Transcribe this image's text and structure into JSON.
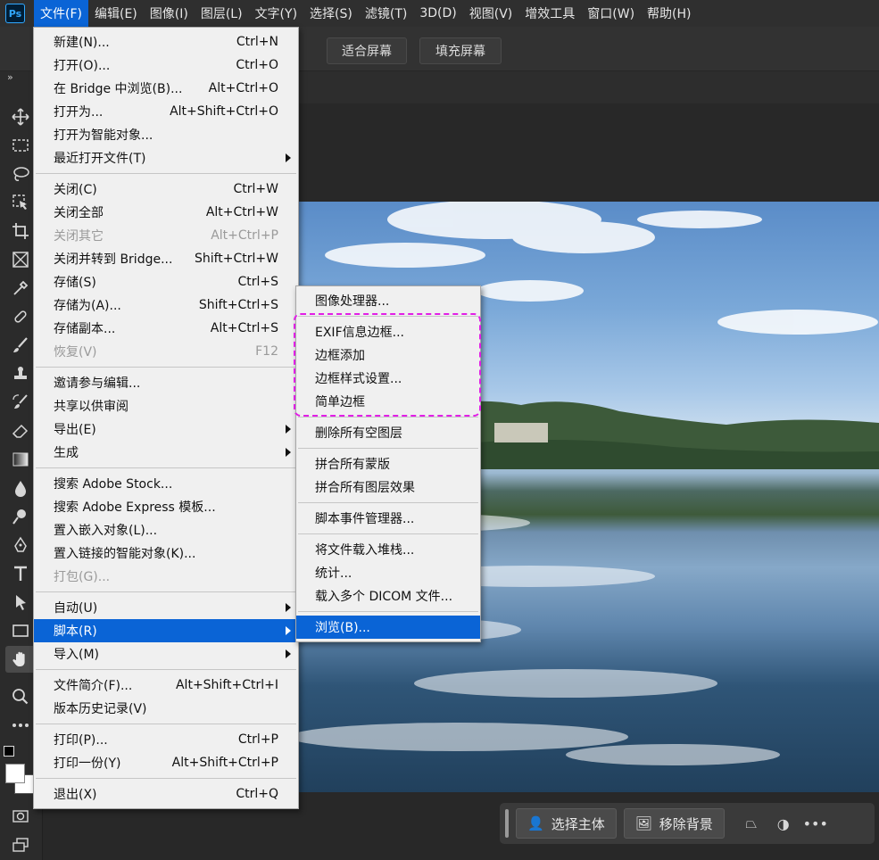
{
  "app": {
    "logo": "Ps",
    "accent": "#0a64d6",
    "highlight_box_color": "#e11ee6"
  },
  "menubar": {
    "items": [
      "文件(F)",
      "编辑(E)",
      "图像(I)",
      "图层(L)",
      "文字(Y)",
      "选择(S)",
      "滤镜(T)",
      "3D(D)",
      "视图(V)",
      "增效工具",
      "窗口(W)",
      "帮助(H)"
    ],
    "active_index": 0
  },
  "options": {
    "fit_screen": "适合屏幕",
    "fill_screen": "填充屏幕"
  },
  "toolbar": {
    "collapse": "»",
    "tools": [
      "move-icon",
      "marquee-icon",
      "lasso-icon",
      "object-select-icon",
      "crop-icon",
      "frame-icon",
      "eyedropper-icon",
      "healing-brush-icon",
      "brush-icon",
      "clone-stamp-icon",
      "history-brush-icon",
      "eraser-icon",
      "gradient-icon",
      "blur-icon",
      "dodge-icon",
      "pen-icon",
      "type-icon",
      "path-select-icon",
      "rectangle-icon",
      "hand-icon",
      "zoom-icon",
      "more-icon"
    ],
    "selected_tool": "hand-icon"
  },
  "file_menu": {
    "new": {
      "label": "新建(N)...",
      "shortcut": "Ctrl+N"
    },
    "open": {
      "label": "打开(O)...",
      "shortcut": "Ctrl+O"
    },
    "browse_bridge": {
      "label": "在 Bridge 中浏览(B)...",
      "shortcut": "Alt+Ctrl+O"
    },
    "open_as": {
      "label": "打开为...",
      "shortcut": "Alt+Shift+Ctrl+O"
    },
    "open_smart": {
      "label": "打开为智能对象..."
    },
    "recent": {
      "label": "最近打开文件(T)"
    },
    "close": {
      "label": "关闭(C)",
      "shortcut": "Ctrl+W"
    },
    "close_all": {
      "label": "关闭全部",
      "shortcut": "Alt+Ctrl+W"
    },
    "close_others": {
      "label": "关闭其它",
      "shortcut": "Alt+Ctrl+P"
    },
    "close_go_bridge": {
      "label": "关闭并转到 Bridge...",
      "shortcut": "Shift+Ctrl+W"
    },
    "save": {
      "label": "存储(S)",
      "shortcut": "Ctrl+S"
    },
    "save_as": {
      "label": "存储为(A)...",
      "shortcut": "Shift+Ctrl+S"
    },
    "save_copy": {
      "label": "存储副本...",
      "shortcut": "Alt+Ctrl+S"
    },
    "revert": {
      "label": "恢复(V)",
      "shortcut": "F12"
    },
    "invite": {
      "label": "邀请参与编辑..."
    },
    "share_review": {
      "label": "共享以供审阅"
    },
    "export": {
      "label": "导出(E)"
    },
    "generate": {
      "label": "生成"
    },
    "search_stock": {
      "label": "搜索 Adobe Stock..."
    },
    "search_express": {
      "label": "搜索 Adobe Express 模板..."
    },
    "place_embedded": {
      "label": "置入嵌入对象(L)..."
    },
    "place_linked": {
      "label": "置入链接的智能对象(K)..."
    },
    "package": {
      "label": "打包(G)..."
    },
    "automate": {
      "label": "自动(U)"
    },
    "scripts": {
      "label": "脚本(R)"
    },
    "import": {
      "label": "导入(M)"
    },
    "file_info": {
      "label": "文件简介(F)...",
      "shortcut": "Alt+Shift+Ctrl+I"
    },
    "version_history": {
      "label": "版本历史记录(V)"
    },
    "print": {
      "label": "打印(P)...",
      "shortcut": "Ctrl+P"
    },
    "print_one": {
      "label": "打印一份(Y)",
      "shortcut": "Alt+Shift+Ctrl+P"
    },
    "exit": {
      "label": "退出(X)",
      "shortcut": "Ctrl+Q"
    }
  },
  "script_menu": {
    "image_processor": "图像处理器...",
    "exif_border": "EXIF信息边框...",
    "add_border": "边框添加",
    "border_style": "边框样式设置...",
    "simple_border": "简单边框",
    "delete_empty_layers": "删除所有空图层",
    "flatten_masks": "拼合所有蒙版",
    "flatten_effects": "拼合所有图层效果",
    "script_events": "脚本事件管理器...",
    "load_stack": "将文件载入堆栈...",
    "statistics": "统计...",
    "load_dicom": "载入多个 DICOM 文件...",
    "browse": "浏览(B)..."
  },
  "taskbar": {
    "select_subject": "选择主体",
    "remove_bg": "移除背景"
  }
}
